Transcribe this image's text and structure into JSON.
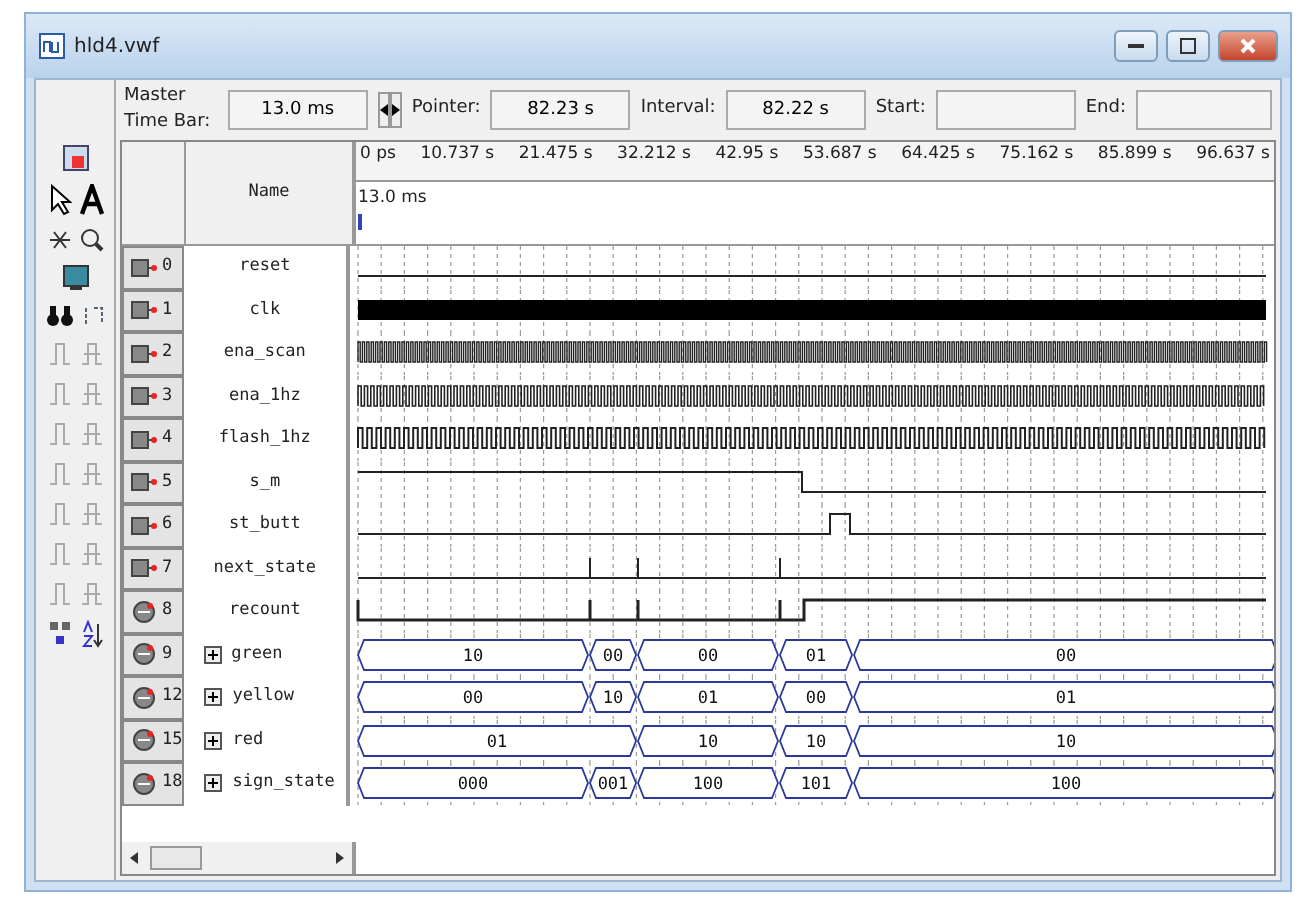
{
  "window": {
    "title": "hld4.vwf"
  },
  "toolbar": {
    "master_time_bar_label": "Master Time Bar:",
    "master_time_bar": "13.0 ms",
    "pointer_label": "Pointer:",
    "pointer": "82.23 s",
    "interval_label": "Interval:",
    "interval": "82.22 s",
    "start_label": "Start:",
    "end_label": "End:"
  },
  "name_header": "Name",
  "ruler": {
    "ticks": [
      "0 ps",
      "10.737 s",
      "21.475 s",
      "32.212 s",
      "42.95 s",
      "53.687 s",
      "64.425 s",
      "75.162 s",
      "85.899 s",
      "96.637 s"
    ],
    "master_time": "13.0 ms"
  },
  "signals": [
    {
      "index": "0",
      "name": "reset",
      "kind": "low"
    },
    {
      "index": "1",
      "name": "clk",
      "kind": "clock"
    },
    {
      "index": "2",
      "name": "ena_scan",
      "kind": "scan"
    },
    {
      "index": "3",
      "name": "ena_1hz",
      "kind": "hz"
    },
    {
      "index": "4",
      "name": "flash_1hz",
      "kind": "flash"
    },
    {
      "index": "5",
      "name": "s_m",
      "kind": "fall"
    },
    {
      "index": "6",
      "name": "st_butt",
      "kind": "pulse"
    },
    {
      "index": "7",
      "name": "next_state",
      "kind": "spikes"
    },
    {
      "index": "8",
      "name": "recount",
      "kind": "recount"
    },
    {
      "index": "9",
      "name": "green",
      "kind": "bus",
      "values": [
        "10",
        "00",
        "00",
        "01",
        "00"
      ]
    },
    {
      "index": "12",
      "name": "yellow",
      "kind": "bus",
      "values": [
        "00",
        "10",
        "01",
        "00",
        "01"
      ]
    },
    {
      "index": "15",
      "name": "red",
      "kind": "bus",
      "values": [
        "01",
        "10",
        "10",
        "10"
      ]
    },
    {
      "index": "18",
      "name": "sign_state",
      "kind": "bus",
      "values": [
        "000",
        "001",
        "100",
        "101",
        "100"
      ]
    }
  ]
}
